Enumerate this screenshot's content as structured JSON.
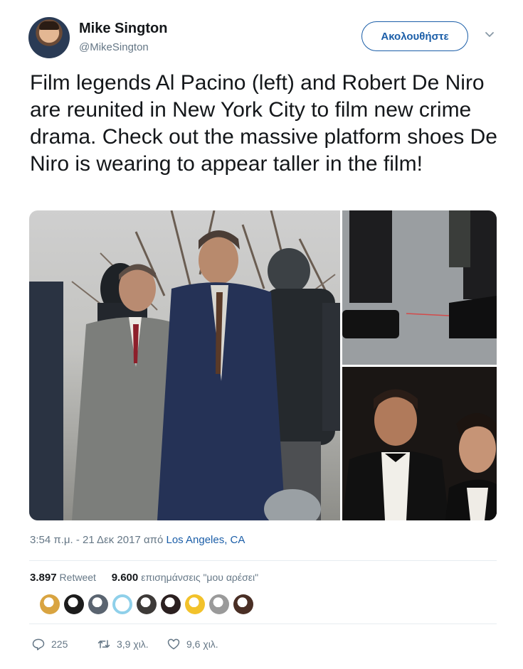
{
  "user": {
    "display_name": "Mike Sington",
    "handle": "@MikeSington",
    "avatar_icon": "profile-photo"
  },
  "follow_button": {
    "label": "Ακολουθήστε",
    "color": "#1b5ea8"
  },
  "caret_icon": "chevron-down-icon",
  "tweet": {
    "text": "Film legends Al Pacino (left) and Robert De Niro are reunited in New York City to film new crime drama. Check out the massive platform shoes De Niro is wearing to appear taller in the film!"
  },
  "media": {
    "photos": [
      "photo-main",
      "photo-shoes",
      "photo-tuxedos"
    ]
  },
  "meta": {
    "time": "3:54 π.μ. - 21 Δεκ 2017 από ",
    "location": "Los Angeles, CA"
  },
  "stats": {
    "retweet_count": "3.897",
    "retweet_label": "Retweet",
    "like_count": "9.600",
    "like_label": "επισημάνσεις \"μου αρέσει\""
  },
  "likers": [
    "#d9a441",
    "#1c1c1c",
    "#5a6470",
    "#8fd0ea",
    "#3d3a38",
    "#2b2020",
    "#f2c22b",
    "#9a9a9a",
    "#4a2f25"
  ],
  "actions": {
    "reply_count": "225",
    "retweet_count": "3,9 χιλ.",
    "like_count": "9,6 χιλ."
  }
}
